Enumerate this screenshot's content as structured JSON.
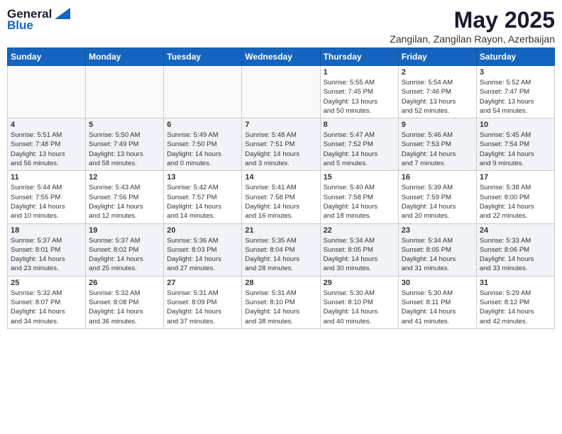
{
  "header": {
    "logo_general": "General",
    "logo_blue": "Blue",
    "main_title": "May 2025",
    "subtitle": "Zangilan, Zangilan Rayon, Azerbaijan"
  },
  "weekdays": [
    "Sunday",
    "Monday",
    "Tuesday",
    "Wednesday",
    "Thursday",
    "Friday",
    "Saturday"
  ],
  "weeks": [
    [
      {
        "day": "",
        "info": ""
      },
      {
        "day": "",
        "info": ""
      },
      {
        "day": "",
        "info": ""
      },
      {
        "day": "",
        "info": ""
      },
      {
        "day": "1",
        "info": "Sunrise: 5:55 AM\nSunset: 7:45 PM\nDaylight: 13 hours\nand 50 minutes."
      },
      {
        "day": "2",
        "info": "Sunrise: 5:54 AM\nSunset: 7:46 PM\nDaylight: 13 hours\nand 52 minutes."
      },
      {
        "day": "3",
        "info": "Sunrise: 5:52 AM\nSunset: 7:47 PM\nDaylight: 13 hours\nand 54 minutes."
      }
    ],
    [
      {
        "day": "4",
        "info": "Sunrise: 5:51 AM\nSunset: 7:48 PM\nDaylight: 13 hours\nand 56 minutes."
      },
      {
        "day": "5",
        "info": "Sunrise: 5:50 AM\nSunset: 7:49 PM\nDaylight: 13 hours\nand 58 minutes."
      },
      {
        "day": "6",
        "info": "Sunrise: 5:49 AM\nSunset: 7:50 PM\nDaylight: 14 hours\nand 0 minutes."
      },
      {
        "day": "7",
        "info": "Sunrise: 5:48 AM\nSunset: 7:51 PM\nDaylight: 14 hours\nand 3 minutes."
      },
      {
        "day": "8",
        "info": "Sunrise: 5:47 AM\nSunset: 7:52 PM\nDaylight: 14 hours\nand 5 minutes."
      },
      {
        "day": "9",
        "info": "Sunrise: 5:46 AM\nSunset: 7:53 PM\nDaylight: 14 hours\nand 7 minutes."
      },
      {
        "day": "10",
        "info": "Sunrise: 5:45 AM\nSunset: 7:54 PM\nDaylight: 14 hours\nand 9 minutes."
      }
    ],
    [
      {
        "day": "11",
        "info": "Sunrise: 5:44 AM\nSunset: 7:55 PM\nDaylight: 14 hours\nand 10 minutes."
      },
      {
        "day": "12",
        "info": "Sunrise: 5:43 AM\nSunset: 7:56 PM\nDaylight: 14 hours\nand 12 minutes."
      },
      {
        "day": "13",
        "info": "Sunrise: 5:42 AM\nSunset: 7:57 PM\nDaylight: 14 hours\nand 14 minutes."
      },
      {
        "day": "14",
        "info": "Sunrise: 5:41 AM\nSunset: 7:58 PM\nDaylight: 14 hours\nand 16 minutes."
      },
      {
        "day": "15",
        "info": "Sunrise: 5:40 AM\nSunset: 7:58 PM\nDaylight: 14 hours\nand 18 minutes."
      },
      {
        "day": "16",
        "info": "Sunrise: 5:39 AM\nSunset: 7:59 PM\nDaylight: 14 hours\nand 20 minutes."
      },
      {
        "day": "17",
        "info": "Sunrise: 5:38 AM\nSunset: 8:00 PM\nDaylight: 14 hours\nand 22 minutes."
      }
    ],
    [
      {
        "day": "18",
        "info": "Sunrise: 5:37 AM\nSunset: 8:01 PM\nDaylight: 14 hours\nand 23 minutes."
      },
      {
        "day": "19",
        "info": "Sunrise: 5:37 AM\nSunset: 8:02 PM\nDaylight: 14 hours\nand 25 minutes."
      },
      {
        "day": "20",
        "info": "Sunrise: 5:36 AM\nSunset: 8:03 PM\nDaylight: 14 hours\nand 27 minutes."
      },
      {
        "day": "21",
        "info": "Sunrise: 5:35 AM\nSunset: 8:04 PM\nDaylight: 14 hours\nand 28 minutes."
      },
      {
        "day": "22",
        "info": "Sunrise: 5:34 AM\nSunset: 8:05 PM\nDaylight: 14 hours\nand 30 minutes."
      },
      {
        "day": "23",
        "info": "Sunrise: 5:34 AM\nSunset: 8:05 PM\nDaylight: 14 hours\nand 31 minutes."
      },
      {
        "day": "24",
        "info": "Sunrise: 5:33 AM\nSunset: 8:06 PM\nDaylight: 14 hours\nand 33 minutes."
      }
    ],
    [
      {
        "day": "25",
        "info": "Sunrise: 5:32 AM\nSunset: 8:07 PM\nDaylight: 14 hours\nand 34 minutes."
      },
      {
        "day": "26",
        "info": "Sunrise: 5:32 AM\nSunset: 8:08 PM\nDaylight: 14 hours\nand 36 minutes."
      },
      {
        "day": "27",
        "info": "Sunrise: 5:31 AM\nSunset: 8:09 PM\nDaylight: 14 hours\nand 37 minutes."
      },
      {
        "day": "28",
        "info": "Sunrise: 5:31 AM\nSunset: 8:10 PM\nDaylight: 14 hours\nand 38 minutes."
      },
      {
        "day": "29",
        "info": "Sunrise: 5:30 AM\nSunset: 8:10 PM\nDaylight: 14 hours\nand 40 minutes."
      },
      {
        "day": "30",
        "info": "Sunrise: 5:30 AM\nSunset: 8:11 PM\nDaylight: 14 hours\nand 41 minutes."
      },
      {
        "day": "31",
        "info": "Sunrise: 5:29 AM\nSunset: 8:12 PM\nDaylight: 14 hours\nand 42 minutes."
      }
    ]
  ]
}
